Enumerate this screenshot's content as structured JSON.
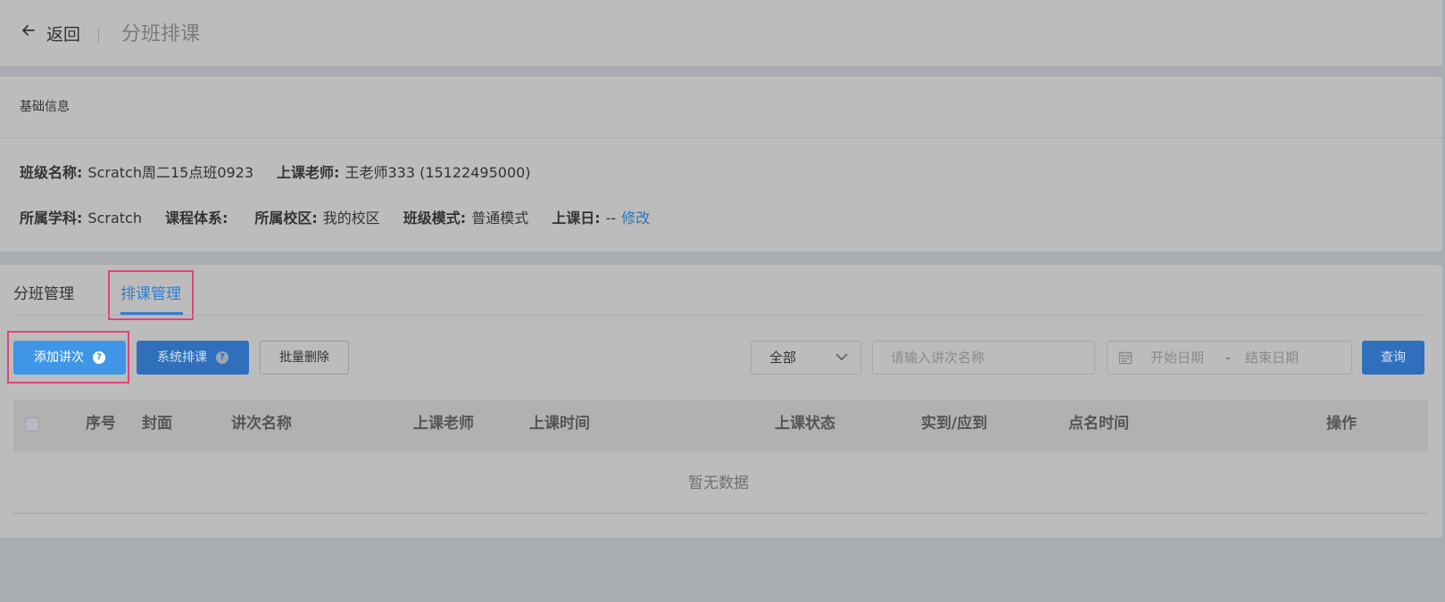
{
  "header": {
    "back_label": "返回",
    "title": "分班排课"
  },
  "info": {
    "title": "基础信息",
    "class_name_label": "班级名称:",
    "class_name_value": "Scratch周二15点班0923",
    "teacher_label": "上课老师:",
    "teacher_value": "王老师333 (15122495000)",
    "subject_label": "所属学科:",
    "subject_value": "Scratch",
    "course_system_label": "课程体系:",
    "campus_label": "所属校区:",
    "campus_value": "我的校区",
    "mode_label": "班级模式:",
    "mode_value": "普通模式",
    "class_day_label": "上课日:",
    "class_day_value": "--",
    "edit_link": "修改"
  },
  "tabs": {
    "items": [
      {
        "label": "分班管理",
        "active": false
      },
      {
        "label": "排课管理",
        "active": true
      }
    ]
  },
  "toolbar": {
    "add_lesson_label": "添加讲次",
    "system_schedule_label": "系统排课",
    "help_glyph": "?",
    "batch_delete_label": "批量删除",
    "status_select_value": "全部",
    "search_placeholder": "请输入讲次名称",
    "start_date_placeholder": "开始日期",
    "date_separator": "-",
    "end_date_placeholder": "结束日期",
    "query_label": "查询"
  },
  "table": {
    "columns": [
      "序号",
      "封面",
      "讲次名称",
      "上课老师",
      "上课时间",
      "上课状态",
      "实到/应到",
      "点名时间",
      "操作"
    ],
    "empty_text": "暂无数据"
  },
  "colors": {
    "primary": "#3f96e6",
    "primary_dark": "#2f6fbc",
    "highlight_border": "#e0437d",
    "link": "#2a73b6",
    "overlay_bg": "#a9acb0"
  },
  "icons": {
    "back": "arrow-left-icon",
    "help": "question-circle-icon",
    "dropdown": "chevron-down-icon",
    "calendar": "calendar-icon"
  }
}
